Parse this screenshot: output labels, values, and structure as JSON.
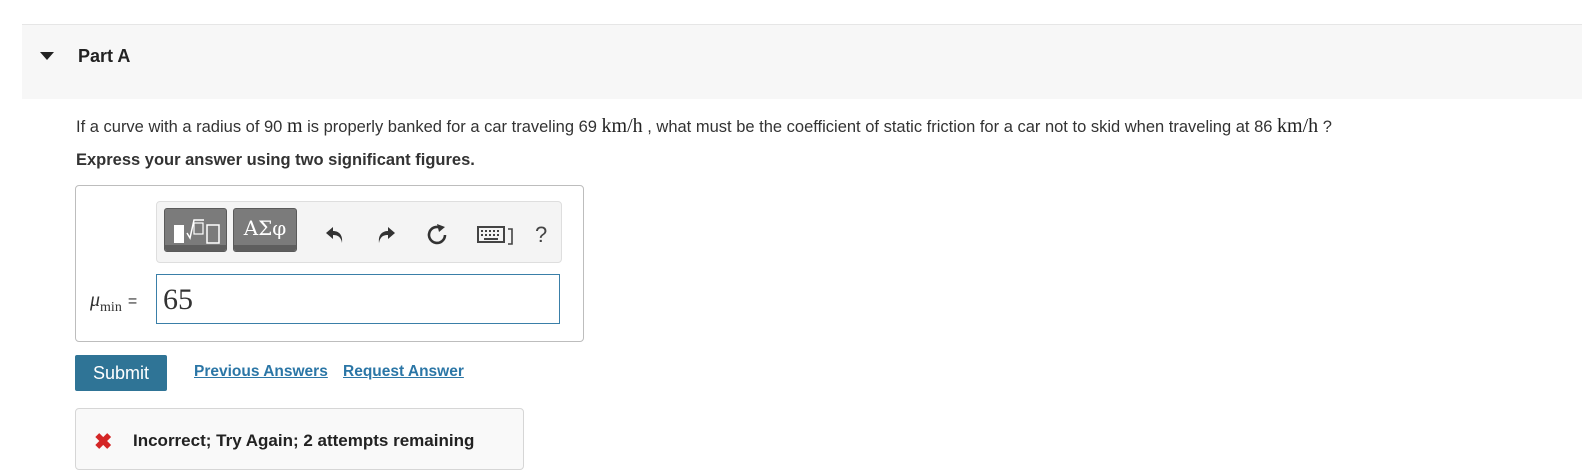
{
  "part": {
    "title": "Part A"
  },
  "question": {
    "pre": "If a curve with a radius of 90",
    "unit_m": "m",
    "mid1": "is properly banked for a car traveling 69",
    "unit_kmh1": "km/h",
    "mid2": ", what must be the coefficient of static friction for a car not to skid when traveling at 86",
    "unit_kmh2": "km/h",
    "post": "?"
  },
  "instruction": "Express your answer using two significant figures.",
  "toolbar": {
    "greek_label": "ΑΣφ",
    "help_label": "?"
  },
  "answer": {
    "symbol": "μ",
    "subscript": "min",
    "equals": "=",
    "value": "65"
  },
  "actions": {
    "submit_label": "Submit",
    "previous_answers_label": "Previous Answers",
    "request_answer_label": "Request Answer"
  },
  "feedback": {
    "message": "Incorrect; Try Again; 2 attempts remaining"
  },
  "colors": {
    "submit_bg": "#2f7496",
    "link": "#2b76a6",
    "error": "#d42626",
    "input_border": "#3a7fa8"
  }
}
